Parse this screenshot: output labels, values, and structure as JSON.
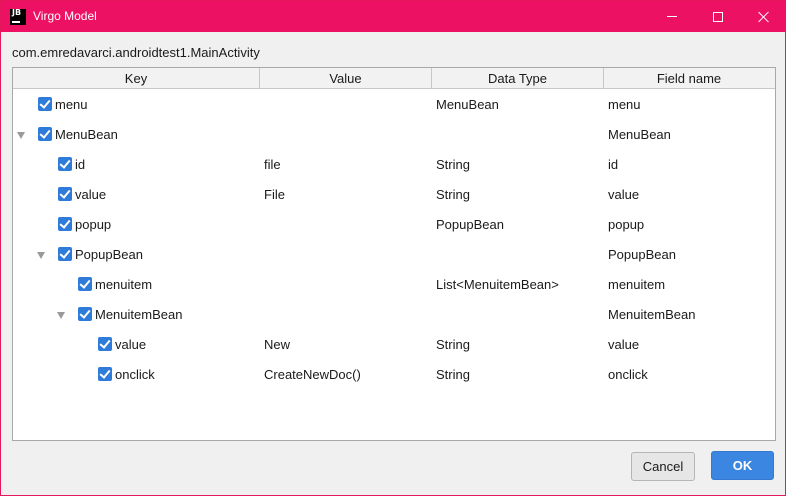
{
  "window": {
    "title": "Virgo Model",
    "icon_text": "JB",
    "controls": [
      "minimize-icon",
      "maximize-icon",
      "close-icon"
    ],
    "accent_color": "#ed1164"
  },
  "class_path": "com.emredavarci.androidtest1.MainActivity",
  "table": {
    "columns": [
      "Key",
      "Value",
      "Data Type",
      "Field name"
    ],
    "rows": [
      {
        "key": "menu",
        "value": "",
        "type": "MenuBean",
        "field": "menu",
        "depth": 0,
        "expandable": false,
        "checked": true
      },
      {
        "key": "MenuBean",
        "value": "",
        "type": "",
        "field": "MenuBean",
        "depth": 0,
        "expandable": true,
        "checked": true
      },
      {
        "key": "id",
        "value": "file",
        "type": "String",
        "field": "id",
        "depth": 1,
        "expandable": false,
        "checked": true
      },
      {
        "key": "value",
        "value": "File",
        "type": "String",
        "field": "value",
        "depth": 1,
        "expandable": false,
        "checked": true
      },
      {
        "key": "popup",
        "value": "",
        "type": "PopupBean",
        "field": "popup",
        "depth": 1,
        "expandable": false,
        "checked": true
      },
      {
        "key": "PopupBean",
        "value": "",
        "type": "",
        "field": "PopupBean",
        "depth": 1,
        "expandable": true,
        "checked": true
      },
      {
        "key": "menuitem",
        "value": "",
        "type": "List<MenuitemBean>",
        "field": "menuitem",
        "depth": 2,
        "expandable": false,
        "checked": true
      },
      {
        "key": "MenuitemBean",
        "value": "",
        "type": "",
        "field": "MenuitemBean",
        "depth": 2,
        "expandable": true,
        "checked": true
      },
      {
        "key": "value",
        "value": "New",
        "type": "String",
        "field": "value",
        "depth": 3,
        "expandable": false,
        "checked": true
      },
      {
        "key": "onclick",
        "value": "CreateNewDoc()",
        "type": "String",
        "field": "onclick",
        "depth": 3,
        "expandable": false,
        "checked": true
      }
    ]
  },
  "buttons": {
    "cancel": "Cancel",
    "ok": "OK"
  }
}
